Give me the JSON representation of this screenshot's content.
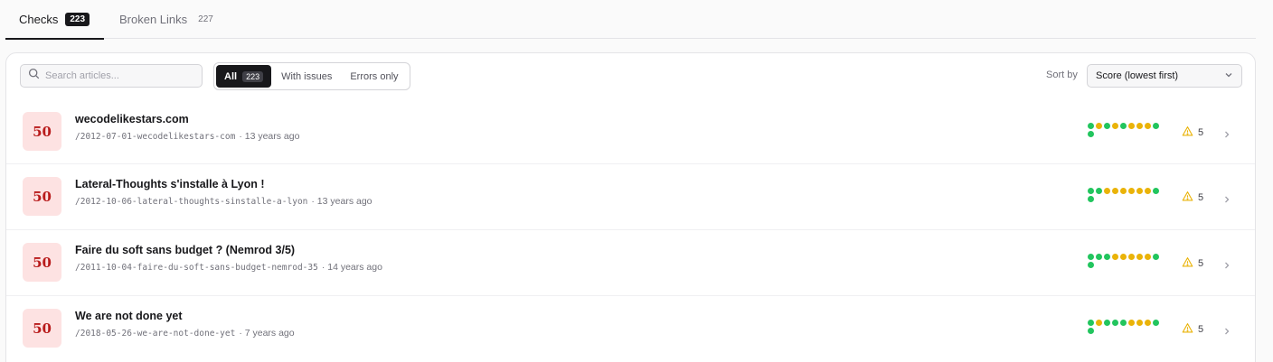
{
  "tabs": [
    {
      "label": "Checks",
      "count": "223"
    },
    {
      "label": "Broken Links",
      "count": "227"
    }
  ],
  "search": {
    "placeholder": "Search articles..."
  },
  "filters": [
    {
      "label": "All",
      "count": "223"
    },
    {
      "label": "With issues"
    },
    {
      "label": "Errors only"
    }
  ],
  "sort": {
    "label": "Sort by",
    "value": "Score (lowest first)"
  },
  "icons": {
    "search": "search-icon",
    "chevron_down": "chevron-down-icon",
    "warning": "warning-icon",
    "chevron_right": "chevron-right-icon"
  },
  "colors": {
    "score_bg": "#fde2e2",
    "score_text": "#b91c1c",
    "pass": "#22c55e",
    "warn": "#eab308",
    "dark": "#18181b"
  },
  "articles": [
    {
      "score": "50",
      "title": "wecodelikestars.com",
      "slug": "/2012-07-01-wecodelikestars-com",
      "age": "· 13 years ago",
      "checks": [
        "pass",
        "warn",
        "pass",
        "warn",
        "pass",
        "warn",
        "warn",
        "warn",
        "pass",
        "pass"
      ],
      "warnings": "5"
    },
    {
      "score": "50",
      "title": "Lateral-Thoughts s'installe à Lyon !",
      "slug": "/2012-10-06-lateral-thoughts-sinstalle-a-lyon",
      "age": "· 13 years ago",
      "checks": [
        "pass",
        "pass",
        "warn",
        "warn",
        "warn",
        "warn",
        "warn",
        "warn",
        "pass",
        "pass"
      ],
      "warnings": "5"
    },
    {
      "score": "50",
      "title": "Faire du soft sans budget ? (Nemrod 3/5)",
      "slug": "/2011-10-04-faire-du-soft-sans-budget-nemrod-35",
      "age": "· 14 years ago",
      "checks": [
        "pass",
        "pass",
        "pass",
        "warn",
        "warn",
        "warn",
        "warn",
        "warn",
        "pass",
        "pass"
      ],
      "warnings": "5"
    },
    {
      "score": "50",
      "title": "We are not done yet",
      "slug": "/2018-05-26-we-are-not-done-yet",
      "age": "· 7 years ago",
      "checks": [
        "pass",
        "warn",
        "pass",
        "pass",
        "pass",
        "warn",
        "warn",
        "warn",
        "pass",
        "pass"
      ],
      "warnings": "5"
    }
  ]
}
